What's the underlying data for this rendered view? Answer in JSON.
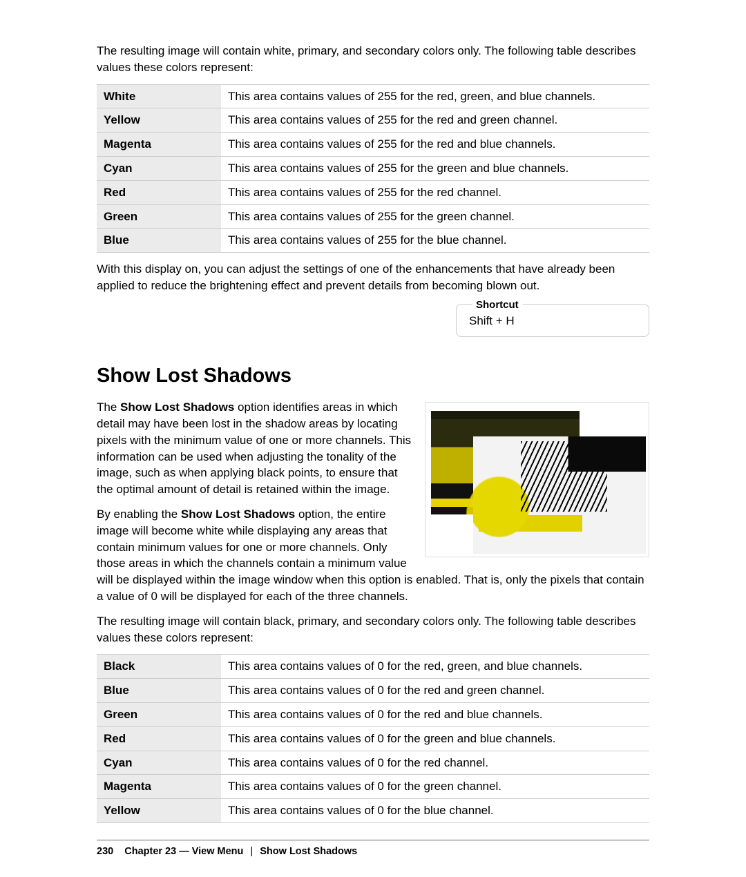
{
  "intro1": "The resulting image will contain white, primary, and secondary colors only. The following table describes values these colors represent:",
  "table1": [
    {
      "label": "White",
      "desc": "This area contains values of 255 for the red, green, and blue channels."
    },
    {
      "label": "Yellow",
      "desc": "This area contains values of 255 for the red and green channel."
    },
    {
      "label": "Magenta",
      "desc": "This area contains values of 255 for the red and blue channels."
    },
    {
      "label": "Cyan",
      "desc": "This area contains values of 255 for the green and blue channels."
    },
    {
      "label": "Red",
      "desc": "This area contains values of 255 for the red channel."
    },
    {
      "label": "Green",
      "desc": "This area contains values of 255 for the green channel."
    },
    {
      "label": "Blue",
      "desc": "This area contains values of 255 for the blue channel."
    }
  ],
  "after1": "With this display on, you can adjust the settings of one of the enhancements that have already been applied to reduce the brightening effect and prevent details from becoming blown out.",
  "shortcut": {
    "legend": "Shortcut",
    "value": "Shift + H"
  },
  "heading": "Show Lost Shadows",
  "p2a_pre": "The ",
  "p2a_bold": "Show Lost Shadows",
  "p2a_post": " option identifies areas in which detail may have been lost in the shadow areas by locating pixels with the minimum value of one or more channels. This information can be used when adjusting the tonality of the image, such as when applying black points, to ensure that the optimal amount of detail is retained within the image.",
  "p2b_pre": "By enabling the ",
  "p2b_bold": "Show Lost Shadows",
  "p2b_post": " option, the entire image will become white while displaying any areas that contain minimum values for one or more channels. Only those areas in which the channels contain a minimum value will be displayed within the image window when this option is enabled. That is, only the pixels that contain a value of 0 will be displayed for each of the three channels.",
  "intro2": "The resulting image will contain black, primary, and secondary colors only. The following table describes values these colors represent:",
  "table2": [
    {
      "label": "Black",
      "desc": "This area contains values of 0 for the red, green, and blue channels."
    },
    {
      "label": "Blue",
      "desc": "This area contains values of 0 for the red and green channel."
    },
    {
      "label": "Green",
      "desc": "This area contains values of 0 for the red and blue channels."
    },
    {
      "label": "Red",
      "desc": "This area contains values of 0 for the green and blue channels."
    },
    {
      "label": "Cyan",
      "desc": "This area contains values of 0 for the red channel."
    },
    {
      "label": "Magenta",
      "desc": "This area contains values of 0 for the green channel."
    },
    {
      "label": "Yellow",
      "desc": "This area contains values of 0 for the blue channel."
    }
  ],
  "footer": {
    "page": "230",
    "chapter": "Chapter 23 — View Menu",
    "sep": "|",
    "section": "Show Lost Shadows"
  }
}
